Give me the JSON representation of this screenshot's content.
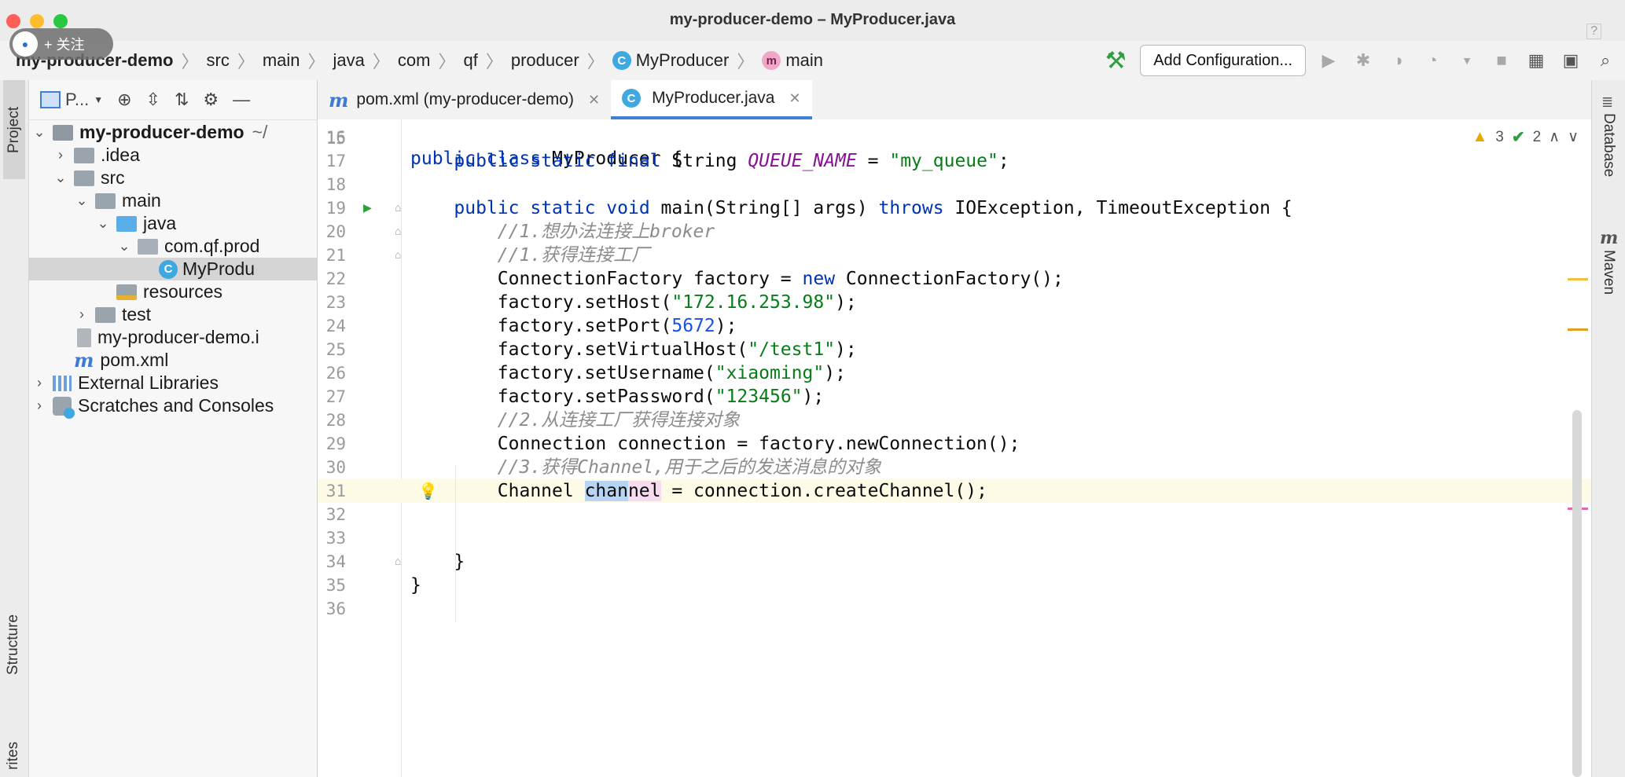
{
  "window": {
    "title": "my-producer-demo – MyProducer.java"
  },
  "overlay": {
    "follow_label": "+ 关注"
  },
  "breadcrumb": [
    "my-producer-demo",
    "src",
    "main",
    "java",
    "com",
    "qf",
    "producer",
    "MyProducer",
    "main"
  ],
  "toolbar": {
    "add_configuration": "Add Configuration...",
    "help": "?"
  },
  "left_strip": {
    "project": "Project",
    "structure": "Structure",
    "favorites": "rites"
  },
  "right_strip": {
    "database": "Database",
    "maven": "Maven"
  },
  "project_panel": {
    "title": "P...",
    "tree": [
      {
        "label": "my-producer-demo",
        "suffix": "~/",
        "indent": 0,
        "expanded": true,
        "icon": "module-folder-icon"
      },
      {
        "label": ".idea",
        "indent": 1,
        "expanded": false,
        "icon": "folder-icon"
      },
      {
        "label": "src",
        "indent": 1,
        "expanded": true,
        "icon": "folder-icon"
      },
      {
        "label": "main",
        "indent": 2,
        "expanded": true,
        "icon": "folder-icon"
      },
      {
        "label": "java",
        "indent": 3,
        "expanded": true,
        "icon": "source-folder-icon"
      },
      {
        "label": "com.qf.prod",
        "indent": 4,
        "expanded": true,
        "icon": "package-icon"
      },
      {
        "label": "MyProdu",
        "indent": 5,
        "icon": "class-icon",
        "selected": true
      },
      {
        "label": "resources",
        "indent": 3,
        "icon": "resources-folder-icon"
      },
      {
        "label": "test",
        "indent": 2,
        "expanded": false,
        "icon": "folder-icon"
      },
      {
        "label": "my-producer-demo.i",
        "indent": 1,
        "icon": "iml-file-icon"
      },
      {
        "label": "pom.xml",
        "indent": 1,
        "icon": "maven-icon"
      },
      {
        "label": "External Libraries",
        "indent": 0,
        "expanded": false,
        "icon": "libraries-icon"
      },
      {
        "label": "Scratches and Consoles",
        "indent": 0,
        "expanded": false,
        "icon": "scratches-icon"
      }
    ]
  },
  "tabs": [
    {
      "label": "pom.xml (my-producer-demo)",
      "icon": "maven-icon",
      "active": false
    },
    {
      "label": "MyProducer.java",
      "icon": "class-icon",
      "active": true
    }
  ],
  "inspections": {
    "warnings": "3",
    "ok": "2"
  },
  "code": {
    "partial_top": "public class MyProducer {",
    "lines": [
      {
        "n": "16",
        "text": ""
      },
      {
        "n": "17",
        "text": "    public static final String QUEUE_NAME = \"my_queue\";"
      },
      {
        "n": "18",
        "text": ""
      },
      {
        "n": "19",
        "text": "    public static void main(String[] args) throws IOException, TimeoutException {"
      },
      {
        "n": "20",
        "text": "        //1.想办法连接上broker"
      },
      {
        "n": "21",
        "text": "        //1.获得连接工厂"
      },
      {
        "n": "22",
        "text": "        ConnectionFactory factory = new ConnectionFactory();"
      },
      {
        "n": "23",
        "text": "        factory.setHost(\"172.16.253.98\");"
      },
      {
        "n": "24",
        "text": "        factory.setPort(5672);"
      },
      {
        "n": "25",
        "text": "        factory.setVirtualHost(\"/test1\");"
      },
      {
        "n": "26",
        "text": "        factory.setUsername(\"xiaoming\");"
      },
      {
        "n": "27",
        "text": "        factory.setPassword(\"123456\");"
      },
      {
        "n": "28",
        "text": "        //2.从连接工厂获得连接对象"
      },
      {
        "n": "29",
        "text": "        Connection connection = factory.newConnection();"
      },
      {
        "n": "30",
        "text": "        //3.获得Channel,用于之后的发送消息的对象"
      },
      {
        "n": "31",
        "text": "        Channel channel = connection.createChannel();"
      },
      {
        "n": "32",
        "text": ""
      },
      {
        "n": "33",
        "text": ""
      },
      {
        "n": "34",
        "text": "    }"
      },
      {
        "n": "35",
        "text": "}"
      },
      {
        "n": "36",
        "text": ""
      }
    ]
  }
}
